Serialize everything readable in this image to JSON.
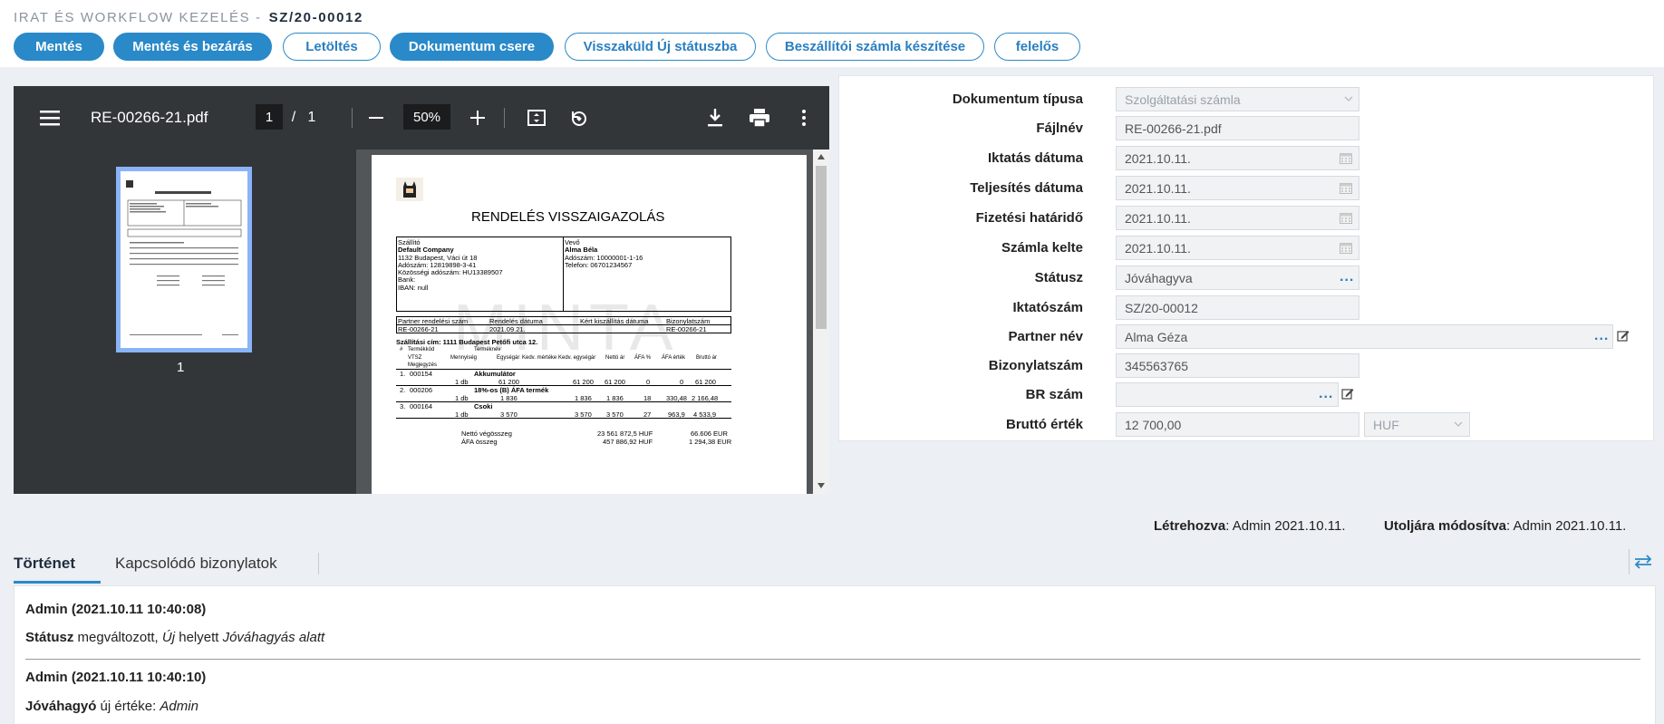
{
  "header": {
    "title": "IRAT ÉS WORKFLOW KEZELÉS -",
    "doc_number": "SZ/20-00012",
    "buttons": {
      "save": "Mentés",
      "save_close": "Mentés és bezárás",
      "download": "Letöltés",
      "replace_document": "Dokumentum csere",
      "send_back": "Visszaküld Új státuszba",
      "create_invoice": "Beszállítói számla készítése",
      "responsible": "felelős"
    }
  },
  "pdf_viewer": {
    "filename": "RE-00266-21.pdf",
    "current_page": "1",
    "page_separator": "/",
    "total_pages": "1",
    "zoom": "50%",
    "thumbnail_number": "1",
    "document": {
      "title": "RENDELÉS VISSZAIGAZOLÁS",
      "watermark": "MINTA",
      "supplier_label": "Szállító",
      "supplier_name": "Default Company",
      "supplier_address": "1132 Budapest, Váci út 18",
      "supplier_tax": "Adószám: 12819898-3-41",
      "supplier_eu_tax": "Közösségi adószám: HU13389507",
      "supplier_bank": "Bank:",
      "supplier_iban": "IBAN: null",
      "buyer_label": "Vevő",
      "buyer_name": "Alma Béla",
      "buyer_tax": "Adószám: 10000001-1-16",
      "buyer_phone": "Telefon: 06701234567",
      "col_partner_order": "Partner rendelési szám",
      "col_order_date": "Rendelés dátuma",
      "col_delivery_date": "Kért kiszállítás dátuma",
      "col_doc_number": "Bizonylatszám",
      "val_partner_order": "RE-00266-21",
      "val_order_date": "2021.09.21.",
      "val_doc_number": "RE-00266-21",
      "shipping_address": "Szállítási cím: 1111 Budapest Petőfi utca 12.",
      "items_header": {
        "hash": "#",
        "code": "Termékkód",
        "name": "Terméknév",
        "vtsz": "VTSZ",
        "qty": "Mennyiség",
        "unit_price": "Egységár",
        "discount": "Kedv. mértéke",
        "disc_price": "Kedv. egységár",
        "net": "Nettó ár",
        "vat_pct": "ÁFA %",
        "vat": "ÁFA érték",
        "gross": "Bruttó ár",
        "note": "Megjegyzés"
      },
      "items": [
        {
          "idx": "1.",
          "code": "000154",
          "name": "Akkumulátor",
          "qty": "1 db",
          "unit_price": "61 200",
          "disc_price": "61 200",
          "net": "61 200",
          "vat_pct": "0",
          "vat": "0",
          "gross": "61 200"
        },
        {
          "idx": "2.",
          "code": "000206",
          "name": "18%-os (B) ÁFA termék",
          "qty": "1 db",
          "unit_price": "1 836",
          "disc_price": "1 836",
          "net": "1 836",
          "vat_pct": "18",
          "vat": "330,48",
          "gross": "2 166,48"
        },
        {
          "idx": "3.",
          "code": "000164",
          "name": "Csoki",
          "qty": "1 db",
          "unit_price": "3 570",
          "disc_price": "3 570",
          "net": "3 570",
          "vat_pct": "27",
          "vat": "963,9",
          "gross": "4 533,9"
        }
      ],
      "totals": [
        {
          "label": "Nettó végösszeg",
          "huf": "23 561 872,5 HUF",
          "eur": "66.606 EUR"
        },
        {
          "label": "ÁFA összeg",
          "huf": "457 886,92 HUF",
          "eur": "1 294,38 EUR"
        }
      ]
    }
  },
  "form": {
    "fields": [
      {
        "label": "Dokumentum típusa",
        "value": "Szolgáltatási számla"
      },
      {
        "label": "Fájlnév",
        "value": "RE-00266-21.pdf"
      },
      {
        "label": "Iktatás dátuma",
        "value": "2021.10.11."
      },
      {
        "label": "Teljesítés dátuma",
        "value": "2021.10.11."
      },
      {
        "label": "Fizetési határidő",
        "value": "2021.10.11."
      },
      {
        "label": "Számla kelte",
        "value": "2021.10.11."
      },
      {
        "label": "Státusz",
        "value": "Jóváhagyva"
      },
      {
        "label": "Iktatószám",
        "value": "SZ/20-00012"
      },
      {
        "label": "Partner név",
        "value": "Alma Géza"
      },
      {
        "label": "Bizonylatszám",
        "value": "345563765"
      },
      {
        "label": "BR szám",
        "value": ""
      },
      {
        "label": "Bruttó érték",
        "value": "12 700,00"
      }
    ],
    "currency": "HUF"
  },
  "meta": {
    "created_label": "Létrehozva",
    "created_value": ": Admin 2021.10.11.",
    "modified_label": "Utoljára módosítva",
    "modified_value": ": Admin 2021.10.11."
  },
  "tabs": {
    "history": "Történet",
    "related": "Kapcsolódó bizonylatok"
  },
  "history": [
    {
      "head": "Admin (2021.10.11 10:40:08)",
      "field": "Státusz",
      "text1": " megváltozott, ",
      "old": "Új",
      "text2": " helyett ",
      "new": "Jóváhagyás alatt"
    },
    {
      "head": "Admin (2021.10.11 10:40:10)",
      "field": "Jóváhagyó",
      "text1": " új értéke: ",
      "new": "Admin"
    }
  ],
  "colors": {
    "accent": "#2a89c8",
    "pdf_toolbar": "#323639",
    "pdf_background": "#525659"
  }
}
